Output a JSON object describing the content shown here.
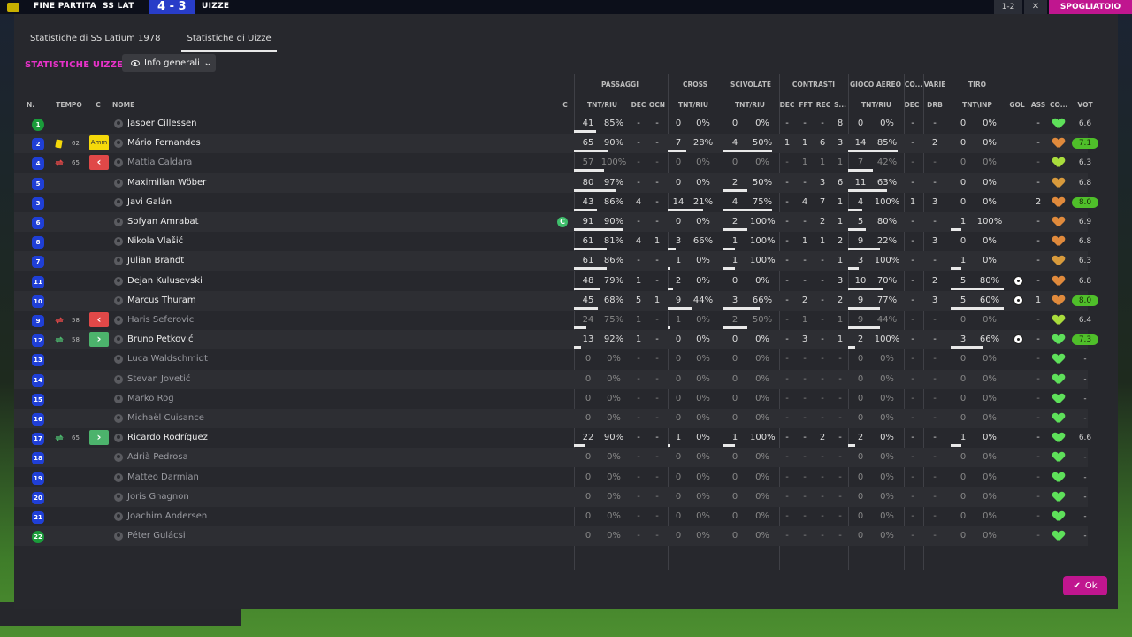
{
  "topbar": {
    "label": "FINE PARTITA",
    "home": "SS LAT",
    "score": "4 - 3",
    "away": "UIZZE",
    "right_tag": "1-2",
    "right_icon": "close-icon",
    "right_btn": "SPOGLIATOIO"
  },
  "tabs": [
    "Statistiche di SS Latium 1978",
    "Statistiche di Uizze"
  ],
  "heading": "STATISTICHE UIZZE",
  "dropdown": "Info generali",
  "groups": {
    "passaggi": "PASSAGGI",
    "cross": "CROSS",
    "scivolate": "SCIVOLATE",
    "contrasti": "CONTRASTI",
    "aereo": "GIOCO AEREO",
    "co": "CO...",
    "varie": "VARIE",
    "tiro": "TIRO"
  },
  "headers": {
    "n": "N.",
    "tempo": "TEMPO",
    "c": "C",
    "nome": "NOME",
    "c2": "C",
    "pass_tr": "TNT/RIU",
    "pass_dec": "DEC",
    "pass_ocn": "OCN",
    "cross_tr": "TNT/RIU",
    "sciv_tr": "TNT/RIU",
    "con_dec": "DEC",
    "con_fft": "FFT",
    "con_rec": "REC",
    "con_s": "S...",
    "aer_tr": "TNT/RIU",
    "co_dec": "DEC",
    "var_drb": "DRB",
    "tiro_tr": "TNT\\INP",
    "gol": "GOL",
    "ass": "ASS",
    "co": "CO...",
    "vot": "VOT"
  },
  "players": [
    {
      "num": "1",
      "kit": "green",
      "name": "Jasper Cillessen",
      "sub": false,
      "pass": [
        "41",
        "85%"
      ],
      "pdec": "-",
      "pocn": "-",
      "cross": [
        "0",
        "0%"
      ],
      "sciv": [
        "0",
        "0%"
      ],
      "con": [
        "-",
        "-",
        "-",
        "8"
      ],
      "aer": [
        "0",
        "0%"
      ],
      "codec": "-",
      "drb": "-",
      "tiro": [
        "0",
        "0%"
      ],
      "gol": "",
      "ass": "-",
      "heart": "#5ee05a",
      "vot": "6.6",
      "hi": false
    },
    {
      "num": "2",
      "kit": "blue",
      "name": "Mário Fernandes",
      "sub": false,
      "yellow": "62",
      "amm": "Amm",
      "pass": [
        "65",
        "90%"
      ],
      "pdec": "-",
      "pocn": "-",
      "cross": [
        "7",
        "28%"
      ],
      "sciv": [
        "4",
        "50%"
      ],
      "con": [
        "1",
        "1",
        "6",
        "3"
      ],
      "aer": [
        "14",
        "85%"
      ],
      "codec": "-",
      "drb": "2",
      "tiro": [
        "0",
        "0%"
      ],
      "gol": "",
      "ass": "-",
      "heart": "#e08a3c",
      "vot": "7.1",
      "hi": true
    },
    {
      "num": "4",
      "kit": "blue",
      "name": "Mattia Caldara",
      "sub": true,
      "subout": "65",
      "pass": [
        "57",
        "100%"
      ],
      "pdec": "-",
      "pocn": "-",
      "cross": [
        "0",
        "0%"
      ],
      "sciv": [
        "0",
        "0%"
      ],
      "con": [
        "-",
        "1",
        "1",
        "1"
      ],
      "aer": [
        "7",
        "42%"
      ],
      "codec": "-",
      "drb": "-",
      "tiro": [
        "0",
        "0%"
      ],
      "gol": "",
      "ass": "-",
      "heart": "#a8dc3c",
      "vot": "6.3",
      "hi": false
    },
    {
      "num": "5",
      "kit": "blue",
      "name": "Maximilian Wöber",
      "sub": false,
      "pass": [
        "80",
        "97%"
      ],
      "pdec": "-",
      "pocn": "-",
      "cross": [
        "0",
        "0%"
      ],
      "sciv": [
        "2",
        "50%"
      ],
      "con": [
        "-",
        "-",
        "3",
        "6"
      ],
      "aer": [
        "11",
        "63%"
      ],
      "codec": "-",
      "drb": "-",
      "tiro": [
        "0",
        "0%"
      ],
      "gol": "",
      "ass": "-",
      "heart": "#d89a3c",
      "vot": "6.8",
      "hi": false
    },
    {
      "num": "3",
      "kit": "blue",
      "name": "Javi Galán",
      "sub": false,
      "pass": [
        "43",
        "86%"
      ],
      "pdec": "4",
      "pocn": "-",
      "cross": [
        "14",
        "21%"
      ],
      "sciv": [
        "4",
        "75%"
      ],
      "con": [
        "-",
        "4",
        "7",
        "1"
      ],
      "aer": [
        "4",
        "100%"
      ],
      "codec": "1",
      "drb": "3",
      "tiro": [
        "0",
        "0%"
      ],
      "gol": "",
      "ass": "2",
      "heart": "#e08a3c",
      "vot": "8.0",
      "hi": true
    },
    {
      "num": "6",
      "kit": "blue",
      "name": "Sofyan Amrabat",
      "sub": false,
      "captain": "C",
      "pass": [
        "91",
        "90%"
      ],
      "pdec": "-",
      "pocn": "-",
      "cross": [
        "0",
        "0%"
      ],
      "sciv": [
        "2",
        "100%"
      ],
      "con": [
        "-",
        "-",
        "2",
        "1"
      ],
      "aer": [
        "5",
        "80%"
      ],
      "codec": "-",
      "drb": "-",
      "tiro": [
        "1",
        "100%"
      ],
      "gol": "",
      "ass": "-",
      "heart": "#e08a3c",
      "vot": "6.9",
      "hi": false
    },
    {
      "num": "8",
      "kit": "blue",
      "name": "Nikola Vlašić",
      "sub": false,
      "pass": [
        "61",
        "81%"
      ],
      "pdec": "4",
      "pocn": "1",
      "cross": [
        "3",
        "66%"
      ],
      "sciv": [
        "1",
        "100%"
      ],
      "con": [
        "-",
        "1",
        "1",
        "2"
      ],
      "aer": [
        "9",
        "22%"
      ],
      "codec": "-",
      "drb": "3",
      "tiro": [
        "0",
        "0%"
      ],
      "gol": "",
      "ass": "-",
      "heart": "#e08a3c",
      "vot": "6.8",
      "hi": false
    },
    {
      "num": "7",
      "kit": "blue",
      "name": "Julian Brandt",
      "sub": false,
      "pass": [
        "61",
        "86%"
      ],
      "pdec": "-",
      "pocn": "-",
      "cross": [
        "1",
        "0%"
      ],
      "sciv": [
        "1",
        "100%"
      ],
      "con": [
        "-",
        "-",
        "-",
        "1"
      ],
      "aer": [
        "3",
        "100%"
      ],
      "codec": "-",
      "drb": "-",
      "tiro": [
        "1",
        "0%"
      ],
      "gol": "",
      "ass": "-",
      "heart": "#d89a3c",
      "vot": "6.3",
      "hi": false
    },
    {
      "num": "11",
      "kit": "blue",
      "name": "Dejan Kulusevski",
      "sub": false,
      "pass": [
        "48",
        "79%"
      ],
      "pdec": "1",
      "pocn": "-",
      "cross": [
        "2",
        "0%"
      ],
      "sciv": [
        "0",
        "0%"
      ],
      "con": [
        "-",
        "-",
        "-",
        "3"
      ],
      "aer": [
        "10",
        "70%"
      ],
      "codec": "-",
      "drb": "2",
      "tiro": [
        "5",
        "80%"
      ],
      "gol": "ball",
      "ass": "-",
      "heart": "#e08a3c",
      "vot": "6.8",
      "hi": false
    },
    {
      "num": "10",
      "kit": "blue",
      "name": "Marcus Thuram",
      "sub": false,
      "pass": [
        "45",
        "68%"
      ],
      "pdec": "5",
      "pocn": "1",
      "cross": [
        "9",
        "44%"
      ],
      "sciv": [
        "3",
        "66%"
      ],
      "con": [
        "-",
        "2",
        "-",
        "2"
      ],
      "aer": [
        "9",
        "77%"
      ],
      "codec": "-",
      "drb": "3",
      "tiro": [
        "5",
        "60%"
      ],
      "gol": "ball",
      "ass": "1",
      "heart": "#e08a3c",
      "vot": "8.0",
      "hi": true
    },
    {
      "num": "9",
      "kit": "blue",
      "name": "Haris Seferovic",
      "sub": true,
      "subout": "58",
      "pass": [
        "24",
        "75%"
      ],
      "pdec": "1",
      "pocn": "-",
      "cross": [
        "1",
        "0%"
      ],
      "sciv": [
        "2",
        "50%"
      ],
      "con": [
        "-",
        "1",
        "-",
        "1"
      ],
      "aer": [
        "9",
        "44%"
      ],
      "codec": "-",
      "drb": "-",
      "tiro": [
        "0",
        "0%"
      ],
      "gol": "",
      "ass": "-",
      "heart": "#a8dc3c",
      "vot": "6.4",
      "hi": false
    },
    {
      "num": "12",
      "kit": "blue",
      "name": "Bruno Petković",
      "sub": false,
      "subin": "58",
      "pass": [
        "13",
        "92%"
      ],
      "pdec": "1",
      "pocn": "-",
      "cross": [
        "0",
        "0%"
      ],
      "sciv": [
        "0",
        "0%"
      ],
      "con": [
        "-",
        "3",
        "-",
        "1"
      ],
      "aer": [
        "2",
        "100%"
      ],
      "codec": "-",
      "drb": "-",
      "tiro": [
        "3",
        "66%"
      ],
      "gol": "ball",
      "ass": "-",
      "heart": "#5ee05a",
      "vot": "7.3",
      "hi": true
    },
    {
      "num": "13",
      "kit": "blue",
      "name": "Luca Waldschmidt",
      "sub": true,
      "pass": [
        "0",
        "0%"
      ],
      "pdec": "-",
      "pocn": "-",
      "cross": [
        "0",
        "0%"
      ],
      "sciv": [
        "0",
        "0%"
      ],
      "con": [
        "-",
        "-",
        "-",
        "-"
      ],
      "aer": [
        "0",
        "0%"
      ],
      "codec": "-",
      "drb": "-",
      "tiro": [
        "0",
        "0%"
      ],
      "gol": "",
      "ass": "-",
      "heart": "#5ee05a",
      "vot": "-",
      "hi": false
    },
    {
      "num": "14",
      "kit": "blue",
      "name": "Stevan Jovetić",
      "sub": true,
      "pass": [
        "0",
        "0%"
      ],
      "pdec": "-",
      "pocn": "-",
      "cross": [
        "0",
        "0%"
      ],
      "sciv": [
        "0",
        "0%"
      ],
      "con": [
        "-",
        "-",
        "-",
        "-"
      ],
      "aer": [
        "0",
        "0%"
      ],
      "codec": "-",
      "drb": "-",
      "tiro": [
        "0",
        "0%"
      ],
      "gol": "",
      "ass": "-",
      "heart": "#5ee05a",
      "vot": "-",
      "hi": false
    },
    {
      "num": "15",
      "kit": "blue",
      "name": "Marko Rog",
      "sub": true,
      "pass": [
        "0",
        "0%"
      ],
      "pdec": "-",
      "pocn": "-",
      "cross": [
        "0",
        "0%"
      ],
      "sciv": [
        "0",
        "0%"
      ],
      "con": [
        "-",
        "-",
        "-",
        "-"
      ],
      "aer": [
        "0",
        "0%"
      ],
      "codec": "-",
      "drb": "-",
      "tiro": [
        "0",
        "0%"
      ],
      "gol": "",
      "ass": "-",
      "heart": "#5ee05a",
      "vot": "-",
      "hi": false
    },
    {
      "num": "16",
      "kit": "blue",
      "name": "Michaël Cuisance",
      "sub": true,
      "pass": [
        "0",
        "0%"
      ],
      "pdec": "-",
      "pocn": "-",
      "cross": [
        "0",
        "0%"
      ],
      "sciv": [
        "0",
        "0%"
      ],
      "con": [
        "-",
        "-",
        "-",
        "-"
      ],
      "aer": [
        "0",
        "0%"
      ],
      "codec": "-",
      "drb": "-",
      "tiro": [
        "0",
        "0%"
      ],
      "gol": "",
      "ass": "-",
      "heart": "#5ee05a",
      "vot": "-",
      "hi": false
    },
    {
      "num": "17",
      "kit": "blue",
      "name": "Ricardo Rodríguez",
      "sub": false,
      "subin": "65",
      "pass": [
        "22",
        "90%"
      ],
      "pdec": "-",
      "pocn": "-",
      "cross": [
        "1",
        "0%"
      ],
      "sciv": [
        "1",
        "100%"
      ],
      "con": [
        "-",
        "-",
        "2",
        "-"
      ],
      "aer": [
        "2",
        "0%"
      ],
      "codec": "-",
      "drb": "-",
      "tiro": [
        "1",
        "0%"
      ],
      "gol": "",
      "ass": "-",
      "heart": "#5ee05a",
      "vot": "6.6",
      "hi": false
    },
    {
      "num": "18",
      "kit": "blue",
      "name": "Adrià Pedrosa",
      "sub": true,
      "pass": [
        "0",
        "0%"
      ],
      "pdec": "-",
      "pocn": "-",
      "cross": [
        "0",
        "0%"
      ],
      "sciv": [
        "0",
        "0%"
      ],
      "con": [
        "-",
        "-",
        "-",
        "-"
      ],
      "aer": [
        "0",
        "0%"
      ],
      "codec": "-",
      "drb": "-",
      "tiro": [
        "0",
        "0%"
      ],
      "gol": "",
      "ass": "-",
      "heart": "#5ee05a",
      "vot": "-",
      "hi": false
    },
    {
      "num": "19",
      "kit": "blue",
      "name": "Matteo Darmian",
      "sub": true,
      "pass": [
        "0",
        "0%"
      ],
      "pdec": "-",
      "pocn": "-",
      "cross": [
        "0",
        "0%"
      ],
      "sciv": [
        "0",
        "0%"
      ],
      "con": [
        "-",
        "-",
        "-",
        "-"
      ],
      "aer": [
        "0",
        "0%"
      ],
      "codec": "-",
      "drb": "-",
      "tiro": [
        "0",
        "0%"
      ],
      "gol": "",
      "ass": "-",
      "heart": "#5ee05a",
      "vot": "-",
      "hi": false
    },
    {
      "num": "20",
      "kit": "blue",
      "name": "Joris Gnagnon",
      "sub": true,
      "pass": [
        "0",
        "0%"
      ],
      "pdec": "-",
      "pocn": "-",
      "cross": [
        "0",
        "0%"
      ],
      "sciv": [
        "0",
        "0%"
      ],
      "con": [
        "-",
        "-",
        "-",
        "-"
      ],
      "aer": [
        "0",
        "0%"
      ],
      "codec": "-",
      "drb": "-",
      "tiro": [
        "0",
        "0%"
      ],
      "gol": "",
      "ass": "-",
      "heart": "#5ee05a",
      "vot": "-",
      "hi": false
    },
    {
      "num": "21",
      "kit": "blue",
      "name": "Joachim Andersen",
      "sub": true,
      "pass": [
        "0",
        "0%"
      ],
      "pdec": "-",
      "pocn": "-",
      "cross": [
        "0",
        "0%"
      ],
      "sciv": [
        "0",
        "0%"
      ],
      "con": [
        "-",
        "-",
        "-",
        "-"
      ],
      "aer": [
        "0",
        "0%"
      ],
      "codec": "-",
      "drb": "-",
      "tiro": [
        "0",
        "0%"
      ],
      "gol": "",
      "ass": "-",
      "heart": "#5ee05a",
      "vot": "-",
      "hi": false
    },
    {
      "num": "22",
      "kit": "green",
      "name": "Péter Gulácsi",
      "sub": true,
      "pass": [
        "0",
        "0%"
      ],
      "pdec": "-",
      "pocn": "-",
      "cross": [
        "0",
        "0%"
      ],
      "sciv": [
        "0",
        "0%"
      ],
      "con": [
        "-",
        "-",
        "-",
        "-"
      ],
      "aer": [
        "0",
        "0%"
      ],
      "codec": "-",
      "drb": "-",
      "tiro": [
        "0",
        "0%"
      ],
      "gol": "",
      "ass": "-",
      "heart": "#5ee05a",
      "vot": "-",
      "hi": false
    }
  ],
  "ok_button": "Ok"
}
